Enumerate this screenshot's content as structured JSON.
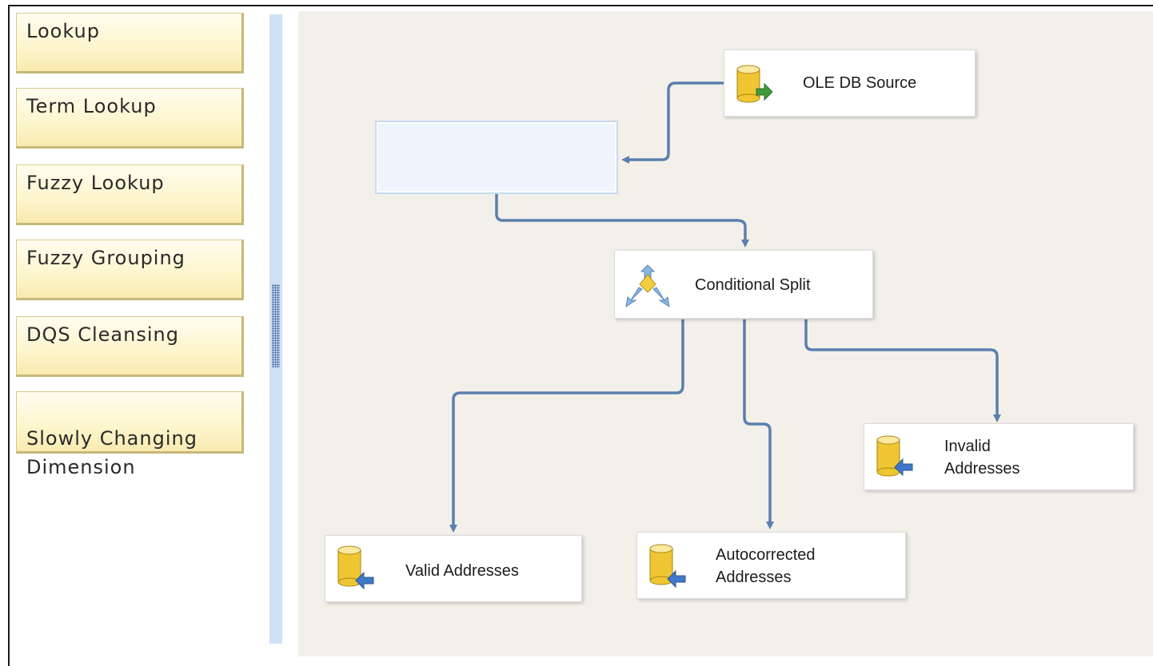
{
  "toolbox": {
    "items": [
      {
        "label": "Lookup"
      },
      {
        "label": "Term Lookup"
      },
      {
        "label": "Fuzzy Lookup"
      },
      {
        "label": "Fuzzy Grouping"
      },
      {
        "label": "DQS Cleansing"
      },
      {
        "label": "Slowly Changing\nDimension"
      }
    ]
  },
  "canvas": {
    "components": {
      "source": {
        "label": "OLE DB Source",
        "icon": "database-source-icon"
      },
      "empty_task": {
        "label": ""
      },
      "split": {
        "label": "Conditional Split",
        "icon": "conditional-split-icon"
      },
      "valid": {
        "label": "Valid Addresses",
        "icon": "database-destination-icon"
      },
      "autocorrected": {
        "label": "Autocorrected\nAddresses",
        "icon": "database-destination-icon"
      },
      "invalid": {
        "label": "Invalid\nAddresses",
        "icon": "database-destination-icon"
      }
    }
  },
  "colors": {
    "canvas_bg": "#f3f0ea",
    "flow_line": "#5b7fae",
    "toolbox_item": "#fdf5cc",
    "splitter": "#cfe0f7"
  }
}
